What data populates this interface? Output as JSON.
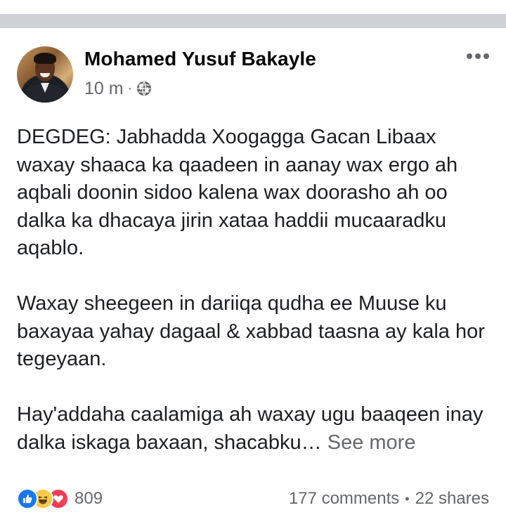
{
  "post": {
    "author": "Mohamed Yusuf Bakayle",
    "time": "10 m",
    "meta_separator": "·",
    "privacy_icon": "globe-icon",
    "menu_icon": "more-horizontal-icon",
    "paragraphs": [
      "DEGDEG: Jabhadda Xoogagga Gacan Libaax waxay shaaca ka qaadeen in aanay wax ergo ah aqbali doonin sidoo kalena wax doorasho ah oo dalka ka dhacaya jirin xataa haddii mucaaradku aqablo.",
      "Waxay sheegeen in dariiqa qudha ee Muuse ku baxayaa yahay dagaal & xabbad taasna ay kala hor tegeyaan.",
      "Hay'addaha caalamiga ah waxay ugu baaqeen inay dalka iskaga baxaan, shacabku…"
    ],
    "see_more": "See more"
  },
  "footer": {
    "reactions": [
      "like-icon",
      "haha-icon",
      "love-icon"
    ],
    "reaction_count": "809",
    "comments": "177 comments",
    "separator": "•",
    "shares": "22 shares"
  },
  "colors": {
    "separator_band": "#cfd1d5",
    "secondary_text": "#65676b",
    "like_blue": "#1877f2",
    "love_red": "#f33e58",
    "haha_yellow": "#f7c948"
  }
}
